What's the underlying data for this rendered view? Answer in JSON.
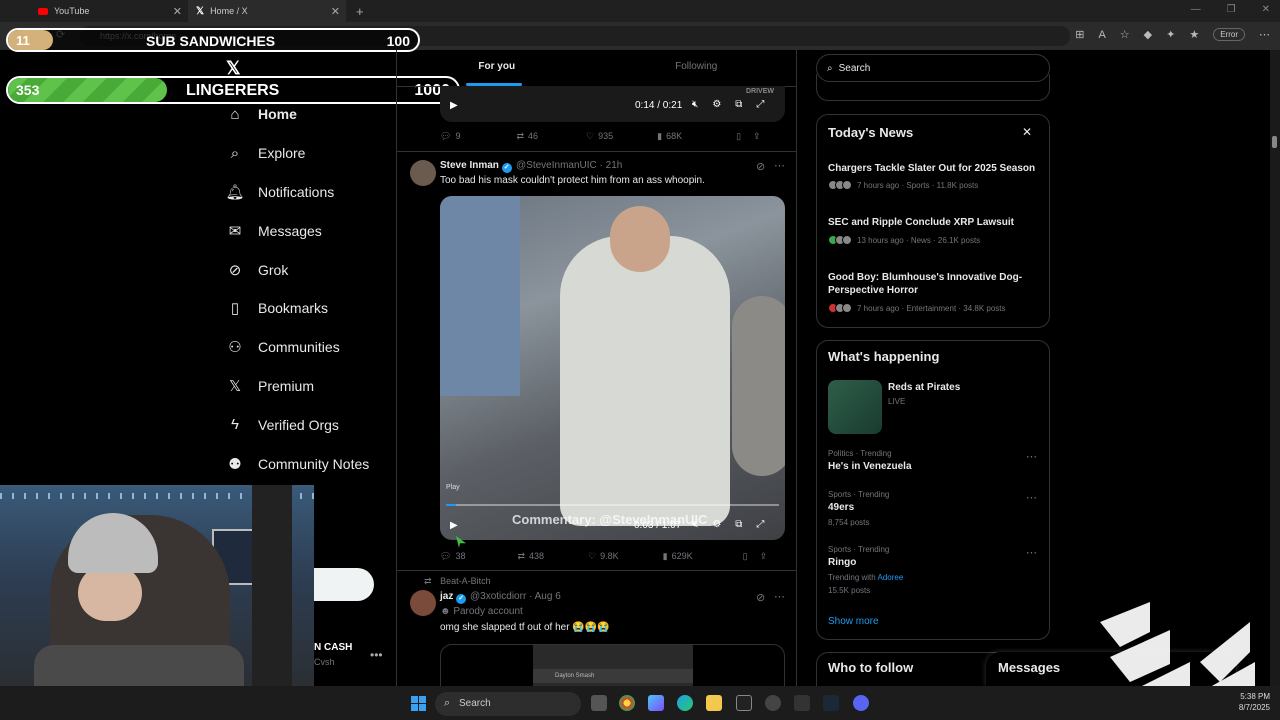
{
  "browser": {
    "tabs": [
      {
        "label": "YouTube"
      },
      {
        "label": "Home / X"
      }
    ],
    "url": "https://x.com/home",
    "error_label": "Error"
  },
  "overlays": {
    "goal1": {
      "current": "11",
      "label": "SUB SANDWICHES",
      "max": "100",
      "progress": 0.11
    },
    "goal2": {
      "current": "353",
      "label": "LINGERERS",
      "max": "1000",
      "progress": 0.353
    }
  },
  "nav": {
    "items": [
      {
        "label": "Home",
        "icon": "home-icon"
      },
      {
        "label": "Explore",
        "icon": "search-icon"
      },
      {
        "label": "Notifications",
        "icon": "bell-icon"
      },
      {
        "label": "Messages",
        "icon": "mail-icon"
      },
      {
        "label": "Grok",
        "icon": "grok-icon"
      },
      {
        "label": "Bookmarks",
        "icon": "bookmark-icon"
      },
      {
        "label": "Communities",
        "icon": "people-icon"
      },
      {
        "label": "Premium",
        "icon": "x-icon"
      },
      {
        "label": "Verified Orgs",
        "icon": "bolt-icon"
      },
      {
        "label": "Community Notes",
        "icon": "notes-icon"
      }
    ],
    "account_name": "N CASH",
    "account_handle": "Cvsh"
  },
  "feed": {
    "tabs": [
      "For you",
      "Following"
    ],
    "video1": {
      "time": "0:14 / 0:21",
      "watermark": "DRIVEW"
    },
    "tweet0_stats": {
      "replies": "9",
      "reposts": "46",
      "likes": "935",
      "views": "68K"
    },
    "tweet1": {
      "name": "Steve Inman",
      "handle": "@SteveInmanUIC",
      "time": "· 21h",
      "text": "Too bad his mask couldn't protect him from an ass whoopin.",
      "video_time": "0:03 / 1:07",
      "play_label": "Play",
      "caption": "Commentary: @SteveInmanUIC",
      "stats": {
        "replies": "38",
        "reposts": "438",
        "likes": "9.8K",
        "views": "629K"
      }
    },
    "tweet2": {
      "reposted_by": "Beat-A-Bitch",
      "name": "jaz",
      "handle": "@3xoticdiorr",
      "time": "· Aug 6",
      "badge": "Parody account",
      "text": "omg she slapped tf out of her 😭😭😭",
      "embed_label": "Dayton Smash"
    }
  },
  "sidebar": {
    "search_placeholder": "Search",
    "show_more_top": "Show more",
    "news": {
      "title": "Today's News",
      "items": [
        {
          "headline": "Chargers Tackle Slater Out for 2025 Season",
          "meta": "7 hours ago · Sports · 11.8K posts"
        },
        {
          "headline": "SEC and Ripple Conclude XRP Lawsuit",
          "meta": "13 hours ago · News · 26.1K posts"
        },
        {
          "headline": "Good Boy: Blumhouse's Innovative Dog-Perspective Horror",
          "meta": "7 hours ago · Entertainment · 34.8K posts"
        }
      ]
    },
    "happening": {
      "title": "What's happening",
      "live": {
        "name": "Reds at Pirates",
        "status": "LIVE"
      },
      "trends": [
        {
          "category": "Politics · Trending",
          "name": "He's in Venezuela",
          "sub": ""
        },
        {
          "category": "Sports · Trending",
          "name": "49ers",
          "sub": "8,754 posts"
        },
        {
          "category": "Sports · Trending",
          "name": "Ringo",
          "sub_prefix": "Trending with",
          "sub_link": "Adoree",
          "sub": "15.5K posts"
        }
      ],
      "show_more": "Show more"
    },
    "who_to_follow": "Who to follow",
    "messages": "Messages"
  },
  "taskbar": {
    "search": "Search",
    "time": "5:38 PM",
    "date": "8/7/2025"
  }
}
